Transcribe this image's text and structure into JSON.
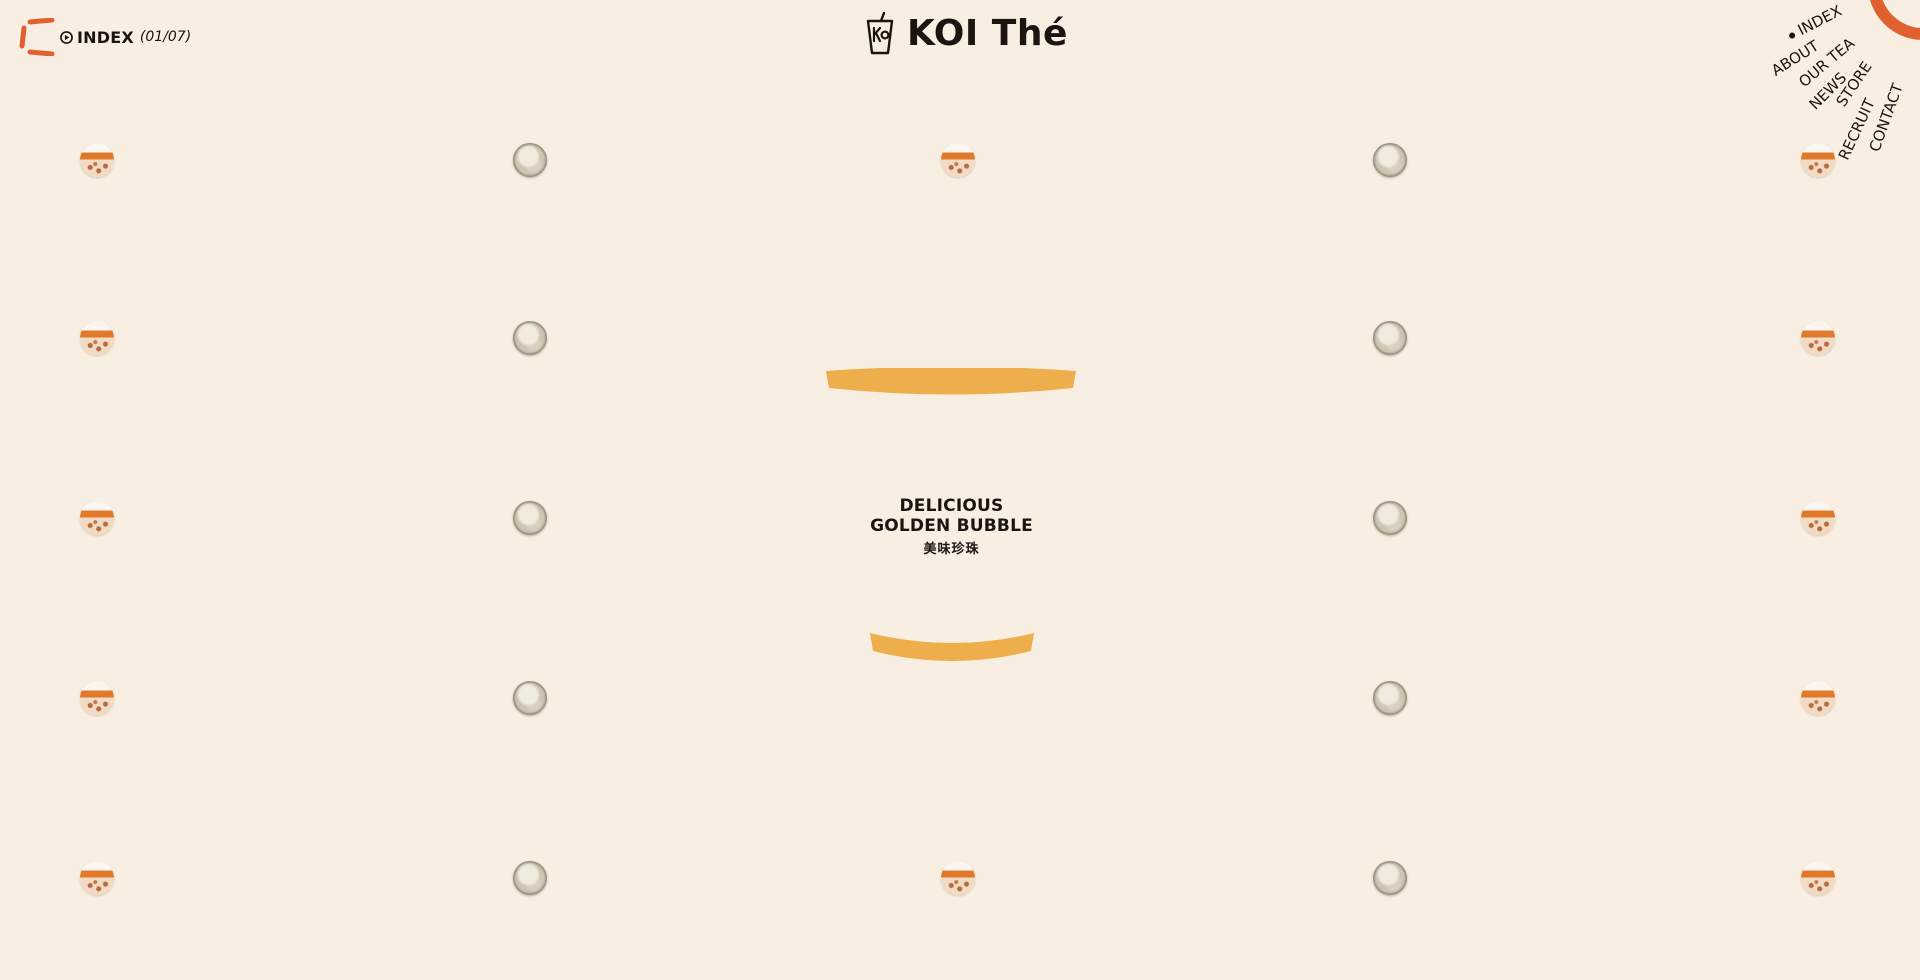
{
  "index_widget": {
    "label": "INDEX",
    "count": "(01/07)"
  },
  "logo": {
    "brand": "KOI Thé"
  },
  "nav": {
    "items": [
      {
        "label": "INDEX",
        "active": true
      },
      {
        "label": "ABOUT",
        "active": false
      },
      {
        "label": "OUR TEA",
        "active": false
      },
      {
        "label": "NEWS",
        "active": false
      },
      {
        "label": "STORE",
        "active": false
      },
      {
        "label": "RECRUIT",
        "active": false
      },
      {
        "label": "CONTACT",
        "active": false
      }
    ]
  },
  "hero": {
    "title_line1": "DELICIOUS",
    "title_line2": "GOLDEN BUBBLE",
    "subtitle": "美味珍珠"
  },
  "colors": {
    "background": "#f8efe2",
    "accent": "#e0602f",
    "bun": "#edae4b",
    "text": "#1b1411"
  },
  "bubbles": {
    "rows": [
      [
        "orange",
        "grey",
        "orange",
        "grey",
        "orange"
      ],
      [
        "orange",
        "grey",
        "",
        "grey",
        "orange"
      ],
      [
        "orange",
        "grey",
        "",
        "grey",
        "orange"
      ],
      [
        "orange",
        "grey",
        "",
        "grey",
        "orange"
      ],
      [
        "orange",
        "grey",
        "orange",
        "grey",
        "orange"
      ]
    ]
  }
}
